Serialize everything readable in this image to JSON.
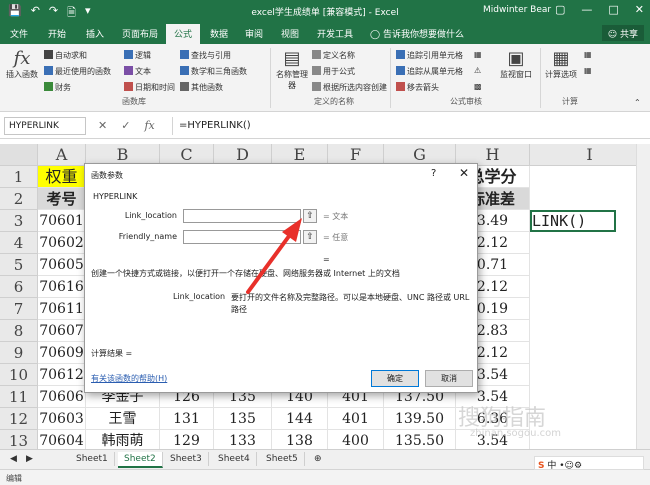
{
  "titlebar": {
    "title": "excel学生成绩单 [兼容模式] - Excel",
    "user": "Midwinter Bear",
    "qa_icons": [
      "save-icon",
      "undo-icon",
      "redo-icon",
      "new-file-icon",
      "customize-icon"
    ]
  },
  "tabs": [
    "文件",
    "开始",
    "插入",
    "页面布局",
    "公式",
    "数据",
    "审阅",
    "视图",
    "开发工具",
    "告诉我你想要做什么"
  ],
  "share_label": "共享",
  "ribbon": {
    "insert_function": "插入函数",
    "lib_col1": [
      "自动求和",
      "最近使用的函数",
      "财务"
    ],
    "lib_col2": [
      "逻辑",
      "文本",
      "日期和时间"
    ],
    "lib_col3": [
      "查找与引用",
      "数学和三角函数",
      "其他函数"
    ],
    "group_library": "函数库",
    "name_manager": "名称管理器",
    "names_col": [
      "定义名称",
      "用于公式",
      "根据所选内容创建"
    ],
    "group_names": "定义的名称",
    "audit_col1": [
      "追踪引用单元格",
      "追踪从属单元格",
      "移去箭头"
    ],
    "group_audit": "公式审核",
    "watch_window": "监视窗口",
    "calc_options": "计算选项",
    "group_calc": "计算"
  },
  "formula_bar": {
    "name_box": "HYPERLINK",
    "formula": "=HYPERLINK()"
  },
  "grid": {
    "columns": [
      "A",
      "B",
      "C",
      "D",
      "E",
      "F",
      "G",
      "H",
      "I"
    ],
    "rows": [
      "1",
      "2",
      "3",
      "4",
      "5",
      "6",
      "7",
      "8",
      "9",
      "10",
      "11",
      "12",
      "13"
    ],
    "row1": [
      "权重",
      "",
      "",
      "",
      "",
      "",
      "",
      "总学分",
      ""
    ],
    "row2": [
      "考号",
      "",
      "",
      "",
      "",
      "",
      "",
      "标准差",
      ""
    ],
    "col_a": [
      "70601",
      "70602",
      "70605",
      "70616",
      "70611",
      "70607",
      "70609",
      "70612",
      "70606",
      "70603",
      "70604"
    ],
    "col_h": [
      "3.49",
      "2.12",
      "0.71",
      "2.12",
      "0.19",
      "2.83",
      "2.12",
      "3.54",
      "3.54",
      "6.36",
      "3.54"
    ],
    "i3": "LINK()",
    "row11": [
      "70606",
      "李金子",
      "126",
      "135",
      "140",
      "401",
      "137.50",
      "3.54"
    ],
    "row12": [
      "70603",
      "王雪",
      "131",
      "135",
      "144",
      "401",
      "139.50",
      "6.36"
    ],
    "row13": [
      "70604",
      "韩雨萌",
      "129",
      "133",
      "138",
      "400",
      "135.50",
      "3.54"
    ]
  },
  "sheets": [
    "Sheet1",
    "Sheet2",
    "Sheet3",
    "Sheet4",
    "Sheet5"
  ],
  "active_sheet": "Sheet2",
  "status": "编辑",
  "dialog": {
    "title": "函数参数",
    "function_name": "HYPERLINK",
    "args": [
      {
        "label": "Link_location",
        "value": "",
        "result": "文本"
      },
      {
        "label": "Friendly_name",
        "value": "",
        "result": "任意"
      }
    ],
    "equals": "=",
    "description": "创建一个快捷方式或链接，以便打开一个存储在硬盘、网络服务器或 Internet 上的文档",
    "arg_help_name": "Link_location",
    "arg_help_text": "要打开的文件名称及完整路径。可以是本地硬盘、UNC 路径或 URL",
    "arg_help_text2": "路径",
    "calc_result": "计算结果 =",
    "help_link": "有关该函数的帮助(H)",
    "ok": "确定",
    "cancel": "取消"
  },
  "watermark": {
    "text": "搜狗指南",
    "url": "zhinan.sogou.com"
  },
  "ime": "中"
}
